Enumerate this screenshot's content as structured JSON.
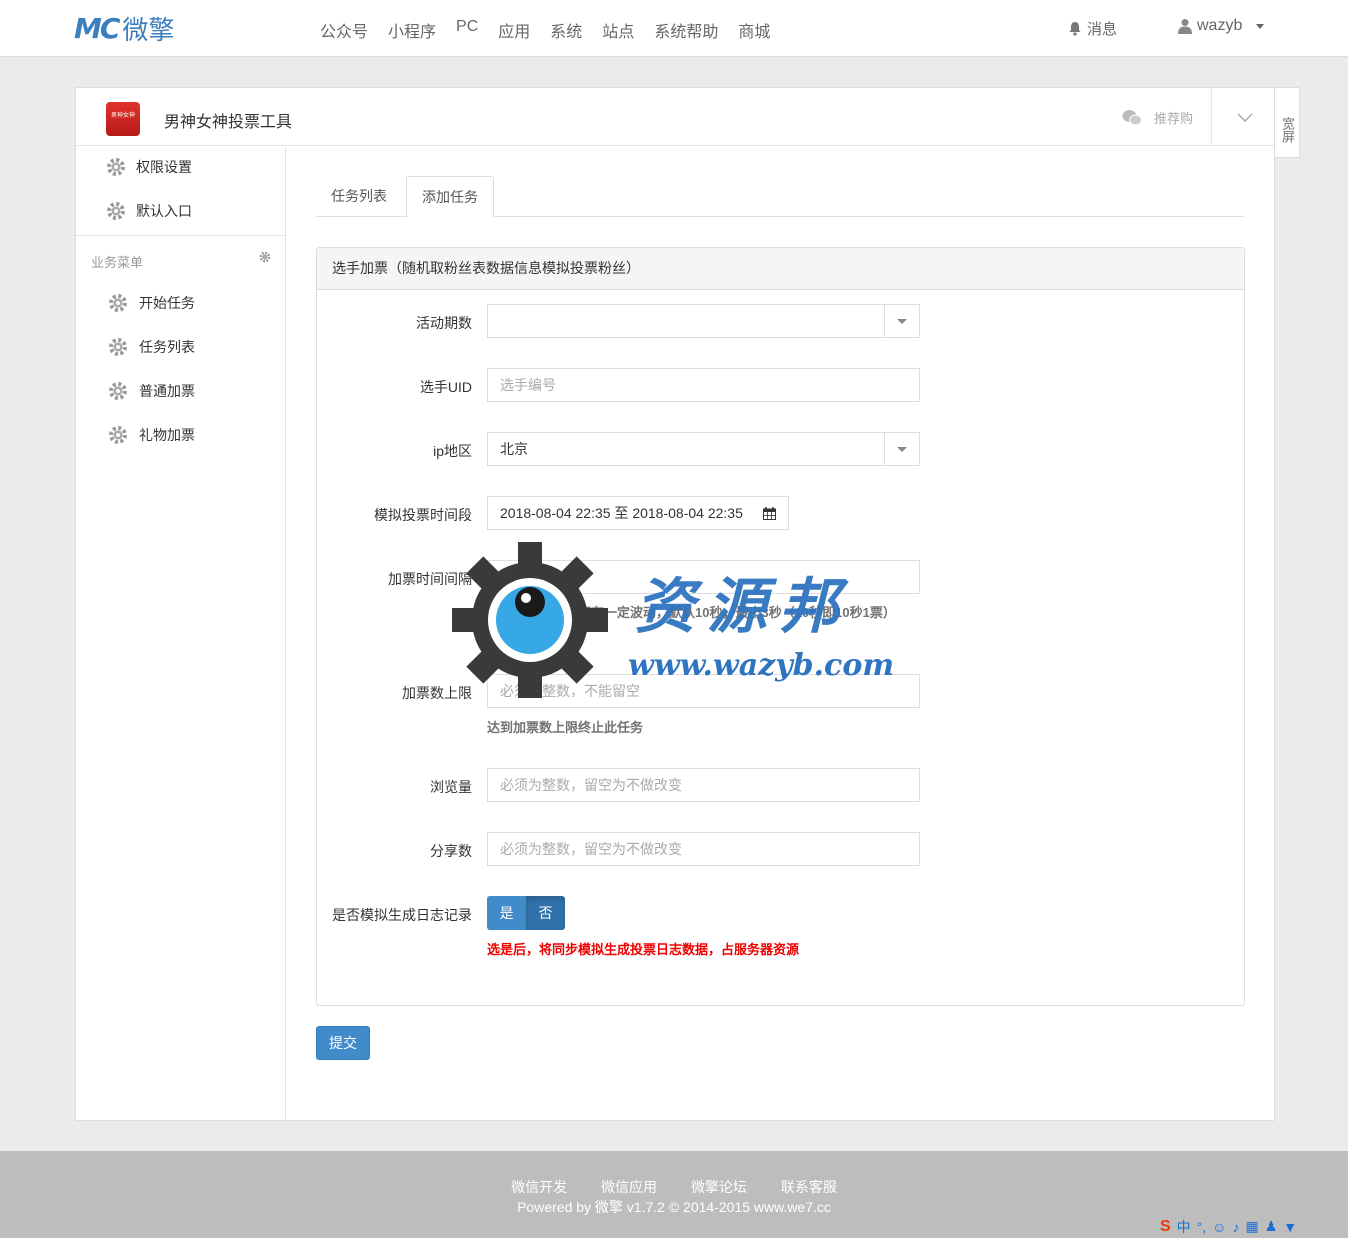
{
  "brand": {
    "mark": "MC",
    "name": "微擎"
  },
  "nav": [
    "公众号",
    "小程序",
    "PC",
    "应用",
    "系统",
    "站点",
    "系统帮助",
    "商城"
  ],
  "header": {
    "messages": "消息",
    "username": "wazyb"
  },
  "app": {
    "icon_text": "男神女神",
    "title": "男神女神投票工具",
    "recommend": "推荐购"
  },
  "wide_screen": "宽屏",
  "sidebar": {
    "top_items": [
      "权限设置",
      "默认入口"
    ],
    "group_title": "业务菜单",
    "group_items": [
      "开始任务",
      "任务列表",
      "普通加票",
      "礼物加票"
    ]
  },
  "tabs": [
    {
      "label": "任务列表",
      "active": false
    },
    {
      "label": "添加任务",
      "active": true
    }
  ],
  "form": {
    "title": "选手加票（随机取粉丝表数据信息模拟投票粉丝）",
    "fields": {
      "period": {
        "label": "活动期数",
        "value": ""
      },
      "uid": {
        "label": "选手UID",
        "placeholder": "选手编号"
      },
      "region": {
        "label": "ip地区",
        "value": "北京"
      },
      "timerange": {
        "label": "模拟投票时间段",
        "value": "2018-08-04 22:35 至 2018-08-04 22:35"
      },
      "interval": {
        "label": "加票时间间隔",
        "value": "10",
        "help": "实际间隔时间上下有一定波动，默认10秒，最小3秒（10秒即10秒1票）"
      },
      "limit": {
        "label": "加票数上限",
        "placeholder": "必须为整数，不能留空",
        "help": "达到加票数上限终止此任务"
      },
      "views": {
        "label": "浏览量",
        "placeholder": "必须为整数，留空为不做改变"
      },
      "shares": {
        "label": "分享数",
        "placeholder": "必须为整数，留空为不做改变"
      },
      "log": {
        "label": "是否模拟生成日志记录",
        "yes": "是",
        "no": "否",
        "help": "选是后，将同步模拟生成投票日志数据，占服务器资源"
      }
    },
    "submit": "提交"
  },
  "watermark": {
    "title": "资源邦",
    "url": "www.wazyb.com"
  },
  "footer": {
    "links": [
      "微信开发",
      "微信应用",
      "微擎论坛",
      "联系客服"
    ],
    "copyright": "Powered by 微擎 v1.7.2 © 2014-2015 www.we7.cc"
  },
  "tray": {
    "ime": "中"
  },
  "colors": {
    "primary": "#428bca",
    "brand": "#3c7fbf",
    "danger": "#e00000"
  }
}
